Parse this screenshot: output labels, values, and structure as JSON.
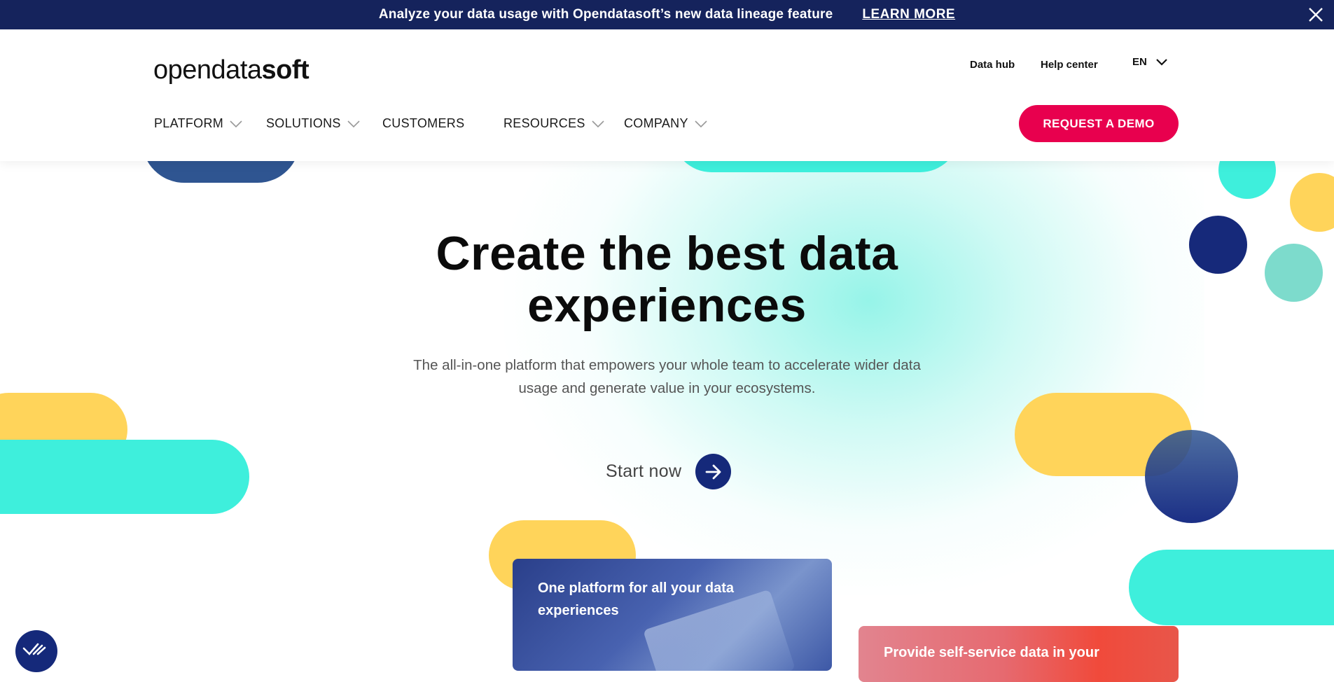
{
  "announcement": {
    "message": "Analyze your data usage with Opendatasoft’s new data lineage feature",
    "link": "LEARN MORE"
  },
  "header": {
    "logo": {
      "part1": "open",
      "part2": "data",
      "part3": "soft"
    },
    "utility_links": [
      "Data hub",
      "Help center"
    ],
    "language": "EN",
    "nav": [
      "PLATFORM",
      "SOLUTIONS",
      "CUSTOMERS",
      "RESOURCES",
      "COMPANY"
    ],
    "cta": "REQUEST A DEMO"
  },
  "hero": {
    "title_line1": "Create the best data",
    "title_line2": "experiences",
    "subtitle_line1": "The all-in-one platform that empowers your whole team to accelerate wider data",
    "subtitle_line2": "usage and generate value in your ecosystems.",
    "cta": "Start now"
  },
  "cards": [
    {
      "title": "One platform for all your data experiences"
    },
    {
      "title": "Provide self-service data in your"
    }
  ],
  "colors": {
    "navy": "#15235c",
    "brand_pink": "#e8004e",
    "turquoise": "#3eefdc",
    "yellow": "#ffd45a",
    "blue": "#2f5591"
  },
  "icons": [
    "close-icon",
    "chevron-down-icon",
    "arrow-right-icon",
    "checkmark-badge-icon"
  ]
}
